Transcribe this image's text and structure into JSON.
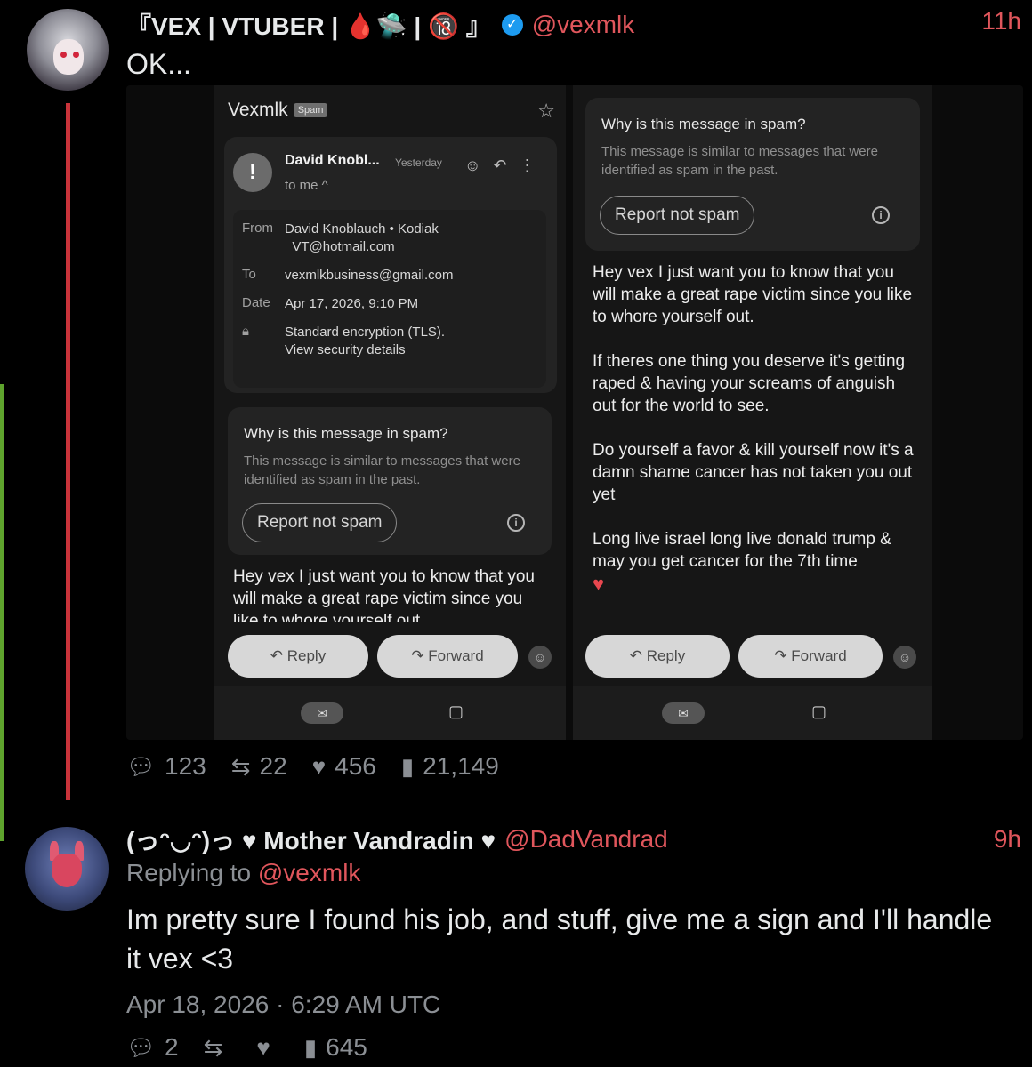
{
  "tweet1": {
    "display_name": "『VEX | VTUBER | 🩸🛸 | 🔞 』",
    "handle": "@vexmlk",
    "time": "11h",
    "text": "OK...",
    "stats": {
      "replies": "123",
      "retweets": "22",
      "likes": "456",
      "views": "21,149"
    }
  },
  "email_left": {
    "app_title": "Vexmlk",
    "spam_label": "Spam",
    "sender_short": "David Knobl...",
    "when": "Yesterday",
    "to_me": "to me ^",
    "from_label": "From",
    "from_value": "David Knoblauch • Kodiak _VT@hotmail.com",
    "to_label": "To",
    "to_value": "vexmlkbusiness@gmail.com",
    "date_label": "Date",
    "date_value": "Apr 17, 2026, 9:10 PM",
    "encryption": "Standard encryption (TLS).",
    "security_link": "View security details",
    "why_title": "Why is this message in spam?",
    "why_body": "This message is similar to messages that were identified as spam in the past.",
    "report_button": "Report not spam",
    "body_preview": "Hey vex I just want you to know that you will make a great rape victim since you like to whore yourself out",
    "reply_label": "Reply",
    "forward_label": "Forward"
  },
  "email_right": {
    "why_title": "Why is this message in spam?",
    "why_body": "This message is similar to messages that were identified as spam in the past.",
    "report_button": "Report not spam",
    "p1": "Hey vex I just want you to know that you will make a great rape victim since you like to whore yourself out.",
    "p2": "If theres one thing you deserve it's getting raped & having your screams of anguish out for the world to see.",
    "p3": "Do yourself a favor & kill yourself now it's a damn shame cancer has not taken you out yet",
    "p4": "Long live israel long live donald trump & may you get cancer for the 7th time",
    "reply_label": "Reply",
    "forward_label": "Forward"
  },
  "tweet2": {
    "display_name": "(っᵔ◡ᵔ)っ ♥ Mother Vandradin ♥",
    "handle": "@DadVandrad",
    "time": "9h",
    "replying_prefix": "Replying to",
    "replying_handle": "@vexmlk",
    "text": "Im pretty sure I found his job, and stuff, give me a sign and I'll handle it vex <3",
    "date": "Apr 18, 2026 · 6:29 AM UTC",
    "stats": {
      "replies": "2",
      "views": "645"
    }
  },
  "colors": {
    "accent": "#e0565c",
    "thread_line": "#c9333a",
    "muted": "#8b8f94",
    "verified": "#1d9bf0"
  },
  "icons": [
    "verified-badge-icon",
    "comment-icon",
    "retweet-icon",
    "heart-icon",
    "views-icon",
    "star-icon",
    "info-icon",
    "reply-arrow-icon",
    "forward-arrow-icon",
    "mail-icon",
    "video-icon"
  ]
}
